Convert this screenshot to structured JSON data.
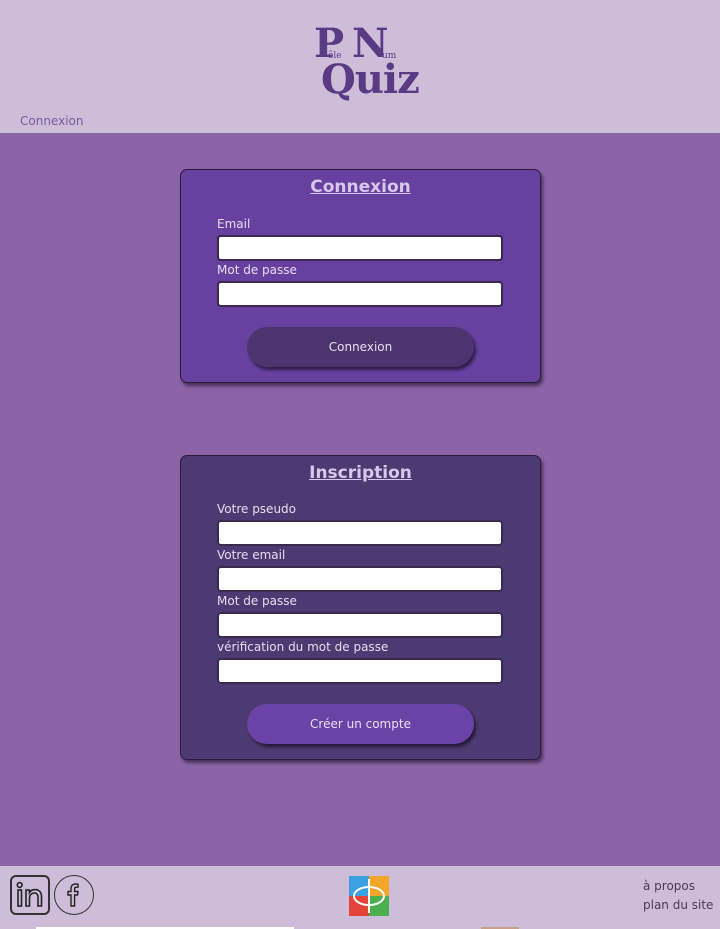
{
  "header": {
    "logo": {
      "p": "P",
      "ole": "ôle",
      "n": "N",
      "um": "um",
      "quiz": "Quiz"
    },
    "breadcrumb": "Connexion"
  },
  "login": {
    "title": "Connexion",
    "email_label": "Email",
    "email_value": "",
    "password_label": "Mot de passe",
    "password_value": "",
    "submit_label": "Connexion"
  },
  "signup": {
    "title": "Inscription",
    "pseudo_label": "Votre pseudo",
    "pseudo_value": "",
    "email_label": "Votre email",
    "email_value": "",
    "password_label": "Mot de passe",
    "password_value": "",
    "confirm_label": "vérification du mot de passe",
    "confirm_value": "",
    "submit_label": "Créer un compte"
  },
  "footer": {
    "social": [
      "linkedin-icon",
      "facebook-icon"
    ],
    "links": {
      "about": "à propos",
      "sitemap": "plan du site"
    }
  },
  "colors": {
    "page_bg": "#8b63a6",
    "header_bg": "#cdbdd9",
    "login_card_bg": "#6841a0",
    "signup_card_bg": "#4e3a72",
    "accent_text": "#5a3a84"
  }
}
